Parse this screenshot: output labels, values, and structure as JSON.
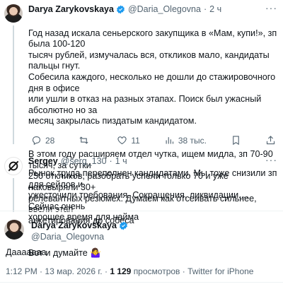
{
  "tweet1": {
    "name": "Darya Zarykovskaya",
    "handle": "@Daria_Olegovna",
    "dot": "·",
    "time": "2 ч",
    "more": "···",
    "paragraphs": [
      "Год назад искала сеньерского закупщика в «Мам, купи!», зп была 100-120\nтысяч рублей, измучалась вся, откликов мало, кандидаты пальцы гнут.\nСобесила каждого, несколько не дошли до стажировочного дня в офисе\nили ушли в отказ на разных этапах. Поиск был ужасный абсолютно но за\nмесяц закрылась пиздатым кандидатом.",
      "В этом году расширяем отдел чутка, ищем мидла, зп 70-90 тысяч, за сутки\n250 откликов, разобрать успели только 70 и уже наковыряли 30+\nрелевантных резюмех. Думаем как отсеивать сильнее, ввели этап\nанкетирования до собеса",
      "Вот и думайте 🤷‍♀️"
    ],
    "replies": "28",
    "retweets": "",
    "likes": "11",
    "views": "38 тыс."
  },
  "tweet2": {
    "name": "Sergey",
    "handle": "@serg_130",
    "dot": "·",
    "time": "1 ч",
    "more": "···",
    "text": "Рынок труда переполнен кандидатами. Мы тоже снизили зп для сейлов и\nужесточили требования. Сокращения, ликвидации.... Сейчас очень\nхорошее время для найма"
  },
  "tweet3": {
    "name": "Darya Zarykovskaya",
    "handle": "@Daria_Olegovna",
    "text": "Дааааааа",
    "time": "1:12 PM",
    "date": "13 мар. 2026 г.",
    "views_count": "1 129",
    "views_label": "просмотров",
    "client": "Twitter for iPhone",
    "sep": "·"
  },
  "colors": {
    "verified": "#1d9bf0",
    "secondary": "#536471",
    "text": "#0f1419"
  }
}
